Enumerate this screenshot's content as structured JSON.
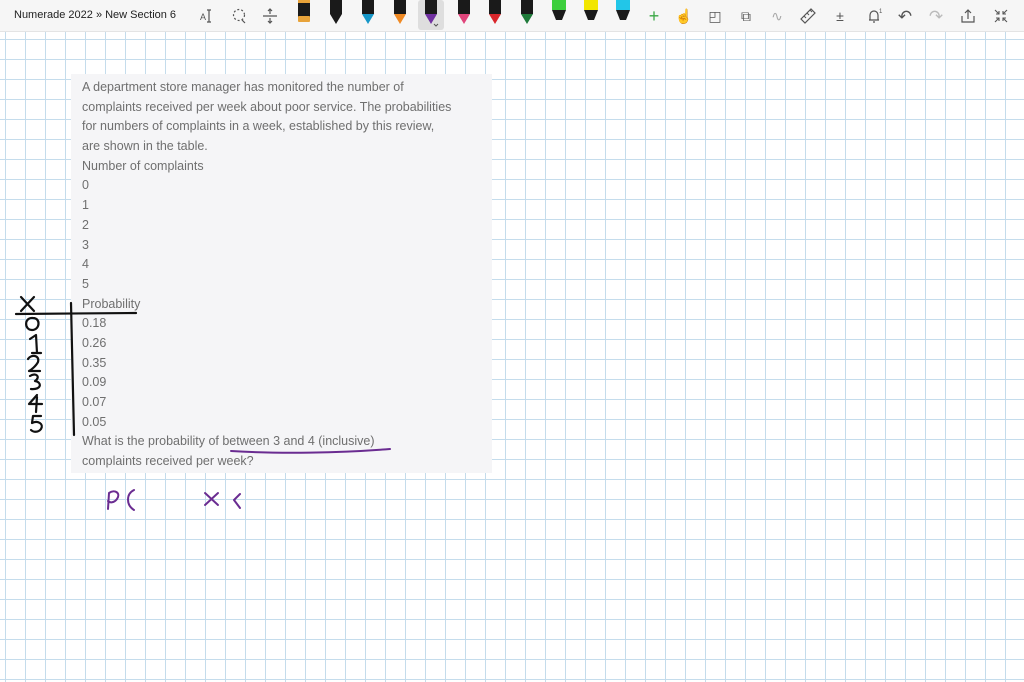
{
  "window": {
    "title": "Numerade 2022 » New Section 6"
  },
  "toolbar": {
    "tools": [
      {
        "name": "text-mode-tool",
        "icon": "text-cursor-icon"
      },
      {
        "name": "lasso-select-tool",
        "icon": "lasso-icon"
      },
      {
        "name": "add-space-tool",
        "icon": "insert-space-icon"
      }
    ],
    "pens": [
      {
        "name": "pen-black",
        "color": "#1a1a1a",
        "tip": "#e8a33a"
      },
      {
        "name": "pen-black-2",
        "color": "#1a1a1a",
        "tip": "#1a1a1a"
      },
      {
        "name": "pen-teal",
        "color": "#1a1a1a",
        "tip": "#1797c8"
      },
      {
        "name": "pen-orange",
        "color": "#1a1a1a",
        "tip": "#f08a24"
      },
      {
        "name": "pen-purple",
        "color": "#1a1a1a",
        "tip": "#7030a0",
        "selected": true
      },
      {
        "name": "pen-pink",
        "color": "#1a1a1a",
        "tip": "#e0457b"
      },
      {
        "name": "pen-red",
        "color": "#1a1a1a",
        "tip": "#d9262b"
      },
      {
        "name": "pen-dark-green",
        "color": "#1a1a1a",
        "tip": "#1f7a3a"
      },
      {
        "name": "highlighter-green",
        "color": "#3ccf3c",
        "tip": "#3ccf3c"
      },
      {
        "name": "highlighter-yellow",
        "color": "#f2e600",
        "tip": "#f2e600"
      },
      {
        "name": "highlighter-cyan",
        "color": "#22c6e8",
        "tip": "#22c6e8"
      }
    ],
    "actions": [
      {
        "name": "add-pen-button",
        "icon": "plus-icon",
        "glyph": "+"
      },
      {
        "name": "touch-drawing-button",
        "icon": "touch-hand-icon",
        "glyph": "☝"
      },
      {
        "name": "shapes-button",
        "icon": "shapes-icon",
        "glyph": "◰"
      },
      {
        "name": "ink-to-shape-button",
        "icon": "ink-to-shape-icon",
        "glyph": "⧉"
      },
      {
        "name": "ink-to-math-button",
        "icon": "ink-to-math-icon",
        "glyph": "∿"
      },
      {
        "name": "ruler-button",
        "icon": "ruler-icon",
        "glyph": "📏"
      },
      {
        "name": "math-button",
        "icon": "math-icon",
        "glyph": "±"
      },
      {
        "name": "replay-button",
        "icon": "replay-icon",
        "glyph": "⟲"
      },
      {
        "name": "undo-button",
        "icon": "undo-icon",
        "glyph": "↶"
      },
      {
        "name": "redo-button",
        "icon": "redo-icon",
        "glyph": "↷"
      },
      {
        "name": "share-button",
        "icon": "share-icon",
        "glyph": "⇪"
      },
      {
        "name": "fullscreen-button",
        "icon": "collapse-icon",
        "glyph": "⤡"
      }
    ]
  },
  "problem": {
    "intro_lines": [
      "A department store manager has monitored the number of",
      "complaints received per week about poor service. The probabilities",
      "for numbers of complaints in a week, established by this review,",
      "are shown in the table."
    ],
    "table_header_x": "Number of complaints",
    "x_values": [
      "0",
      "1",
      "2",
      "3",
      "4",
      "5"
    ],
    "table_header_p": "Probability",
    "p_values": [
      "0.18",
      "0.26",
      "0.35",
      "0.09",
      "0.07",
      "0.05"
    ],
    "question_lines": [
      "What is the probability of between 3 and 4 (inclusive)",
      "complaints received per week?"
    ]
  },
  "ink": {
    "black_color": "#111111",
    "purple_color": "#6a2c91"
  }
}
